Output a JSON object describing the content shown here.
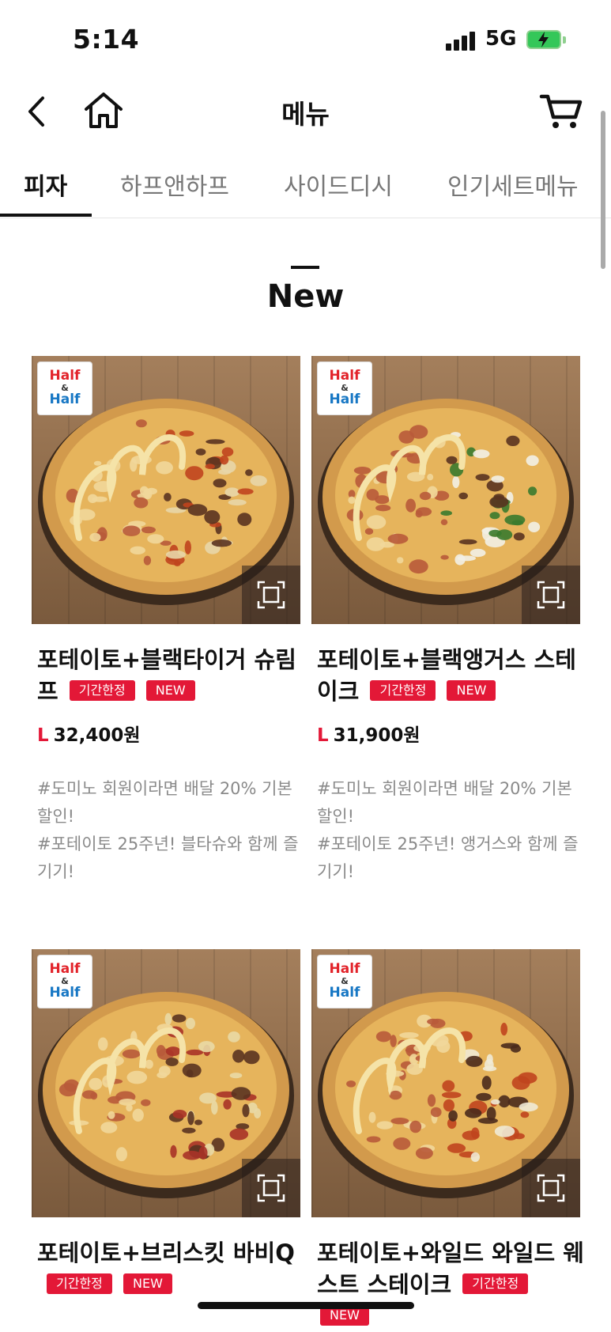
{
  "status": {
    "time": "5:14",
    "network": "5G"
  },
  "header": {
    "title": "메뉴"
  },
  "tabs": [
    {
      "label": "피자",
      "active": true
    },
    {
      "label": "하프앤하프",
      "active": false
    },
    {
      "label": "사이드디시",
      "active": false
    },
    {
      "label": "인기세트메뉴",
      "active": false
    }
  ],
  "section": {
    "title": "New"
  },
  "badge_labels": {
    "limited": "기간한정",
    "new": "NEW"
  },
  "products": [
    {
      "logo": {
        "line1": "Half",
        "amp": "&",
        "line2": "Half"
      },
      "name": "포테이토+블랙타이거 슈림프",
      "badges": [
        "기간한정",
        "NEW"
      ],
      "size": "L",
      "price": "32,400원",
      "desc": "#도미노 회원이라면 배달 20% 기본할인!\n#포테이토 25주년! 블타슈와 함께 즐기기!"
    },
    {
      "logo": {
        "line1": "Half",
        "amp": "&",
        "line2": "Half"
      },
      "name": "포테이토+블랙앵거스 스테이크",
      "badges": [
        "기간한정",
        "NEW"
      ],
      "size": "L",
      "price": "31,900원",
      "desc": "#도미노 회원이라면 배달 20% 기본할인!\n#포테이토 25주년! 앵거스와 함께 즐기기!"
    },
    {
      "logo": {
        "line1": "Half",
        "amp": "&",
        "line2": "Half"
      },
      "name": "포테이토+브리스킷 바비Q",
      "badges": [
        "기간한정",
        "NEW"
      ]
    },
    {
      "logo": {
        "line1": "Half",
        "amp": "&",
        "line2": "Half"
      },
      "name": "포테이토+와일드 와일드 웨스트 스테이크",
      "badges": [
        "기간한정",
        "NEW"
      ]
    }
  ],
  "colors": {
    "accent": "#e31837",
    "text": "#111111",
    "muted": "#8a8a8a"
  }
}
